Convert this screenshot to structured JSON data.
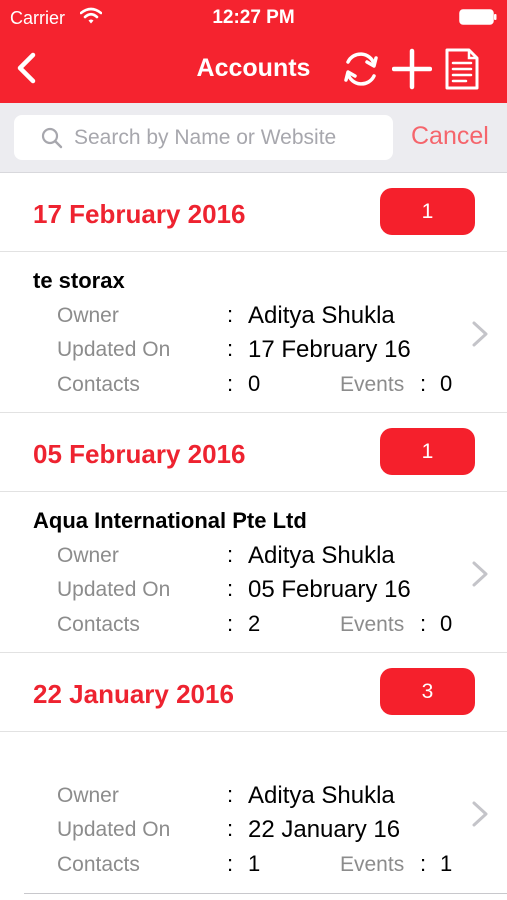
{
  "status_bar": {
    "carrier": "Carrier",
    "time": "12:27 PM"
  },
  "nav": {
    "title": "Accounts",
    "back_icon": "chevron-left-icon",
    "refresh_icon": "refresh-icon",
    "add_icon": "plus-icon",
    "report_icon": "document-icon"
  },
  "search": {
    "placeholder": "Search by Name or Website",
    "value": "",
    "cancel_label": "Cancel"
  },
  "labels": {
    "owner": "Owner",
    "updated_on": "Updated On",
    "contacts": "Contacts",
    "events": "Events",
    "colon": ":"
  },
  "colors": {
    "brand_red": "#f5232f",
    "section_date": "#ee2330",
    "cancel": "#f5656c"
  },
  "sections": [
    {
      "date": "17 February 2016",
      "count": "1",
      "account": {
        "name": "te storax",
        "owner": "Aditya Shukla",
        "updated_on": "17 February 16",
        "contacts": "0",
        "events": "0"
      }
    },
    {
      "date": "05 February 2016",
      "count": "1",
      "account": {
        "name": "Aqua International Pte Ltd",
        "owner": "Aditya Shukla",
        "updated_on": "05 February 16",
        "contacts": "2",
        "events": "0"
      }
    },
    {
      "date": "22 January 2016",
      "count": "3",
      "account": {
        "name": "",
        "owner": "Aditya Shukla",
        "updated_on": "22 January 16",
        "contacts": "1",
        "events": "1"
      }
    }
  ]
}
